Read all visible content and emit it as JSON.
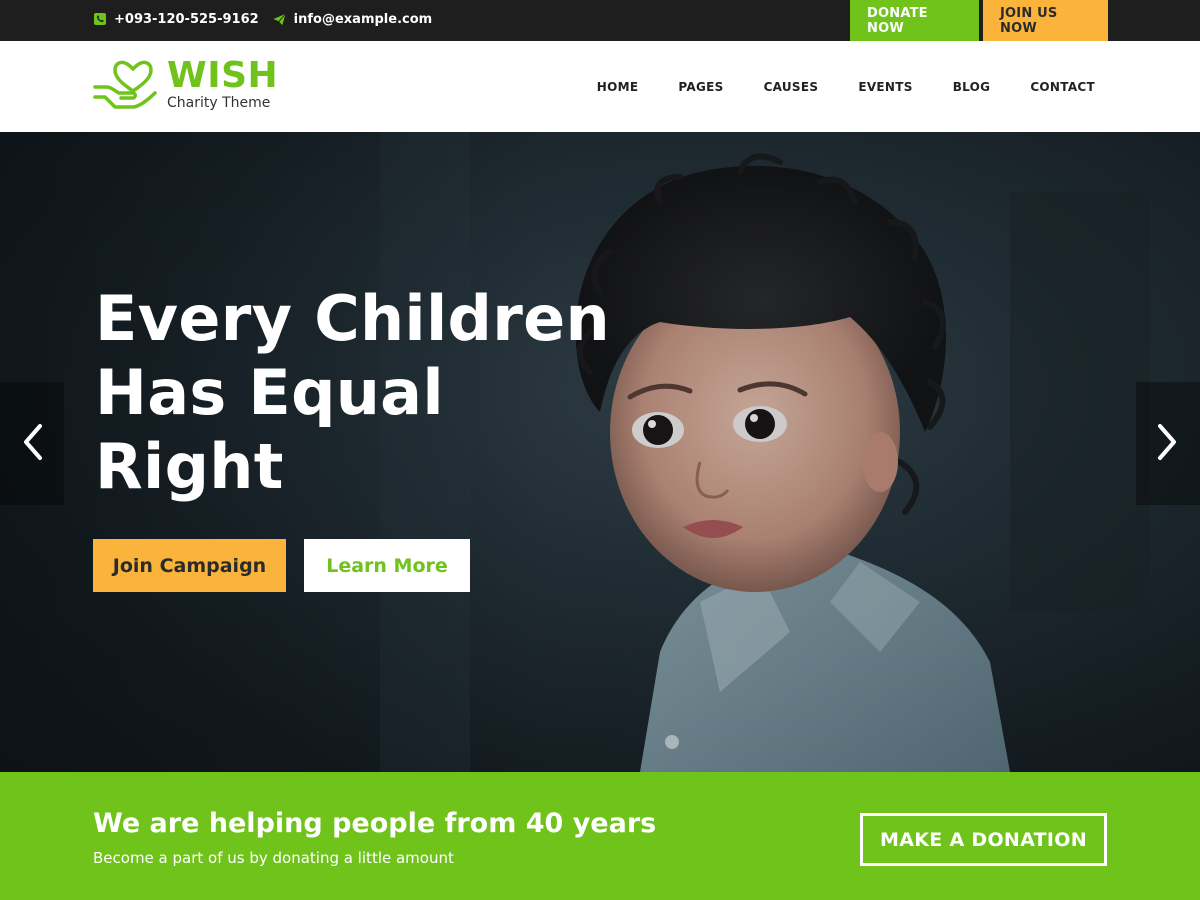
{
  "topbar": {
    "phone": "+093-120-525-9162",
    "email": "info@example.com",
    "donate_label": "DONATE NOW",
    "join_label": "JOIN US NOW"
  },
  "header": {
    "logo_name": "WISH",
    "logo_tagline": "Charity Theme",
    "nav": [
      "HOME",
      "PAGES",
      "CAUSES",
      "EVENTS",
      "BLOG",
      "CONTACT"
    ]
  },
  "hero": {
    "headline_lines": [
      "Every Children",
      "Has Equal",
      "Right"
    ],
    "primary_cta": "Join Campaign",
    "secondary_cta": "Learn More"
  },
  "banner": {
    "title": "We are helping people from 40 years",
    "subtitle": "Become a part of us by donating a little amount",
    "button": "MAKE A DONATION"
  },
  "colors": {
    "brand_green": "#6fc31b",
    "accent_yellow": "#fbb43b",
    "topbar_bg": "#1e1e1e"
  },
  "icons": {
    "phone": "phone-icon",
    "email": "paper-plane-icon",
    "logo": "heart-hand-icon",
    "prev": "chevron-left-icon",
    "next": "chevron-right-icon"
  }
}
